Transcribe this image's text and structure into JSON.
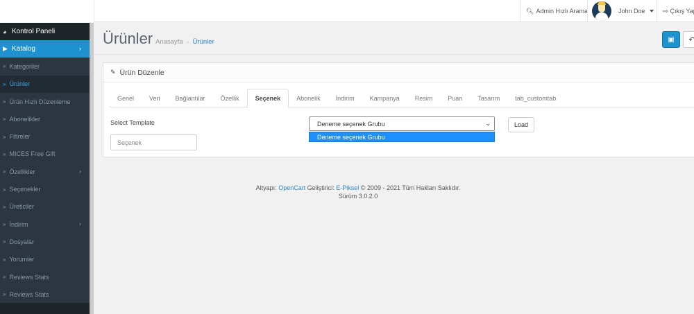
{
  "header": {
    "search_label": "Admin Hızlı Arama",
    "user_name": "John Doe",
    "logout_label": "Çıkış Yap"
  },
  "sidebar": {
    "items": [
      {
        "label": "Kontrol Paneli",
        "icon": "dashboard-icon"
      },
      {
        "label": "Katalog",
        "icon": "tag-icon"
      },
      {
        "label": "Kategoriler"
      },
      {
        "label": "Ürünler"
      },
      {
        "label": "Ürün Hızlı Düzenleme"
      },
      {
        "label": "Abonelikler"
      },
      {
        "label": "Filtreler"
      },
      {
        "label": "MICES Free Gift"
      },
      {
        "label": "Özellikler"
      },
      {
        "label": "Seçenekler"
      },
      {
        "label": "Üreticiler"
      },
      {
        "label": "İndirim"
      },
      {
        "label": "Dosyalar"
      },
      {
        "label": "Yorumlar"
      },
      {
        "label": "Reviews Stats"
      },
      {
        "label": "Reviews Stats"
      }
    ]
  },
  "page": {
    "title": "Ürünler",
    "breadcrumb": [
      "Anasayfa",
      "Ürünler"
    ]
  },
  "panel": {
    "heading": "Ürün Düzenle",
    "tabs": [
      "Genel",
      "Veri",
      "Bağlantılar",
      "Özellik",
      "Seçenek",
      "Abonelik",
      "İndirim",
      "Kampanya",
      "Resim",
      "Puan",
      "Tasarım",
      "tab_customtab"
    ],
    "active_tab": "Seçenek"
  },
  "form": {
    "select_template_label": "Select Template",
    "template_value": "Deneme seçenek Grubu",
    "dropdown_option": "Deneme seçenek Grubu",
    "load_label": "Load",
    "option_placeholder": "Seçenek"
  },
  "footer": {
    "prefix": "Altyapı:",
    "opencart": "OpenCart",
    "dev_label": "Geliştirici:",
    "developer": "E-Piksel",
    "copyright": "© 2009 - 2021 Tüm Hakları Saklıdır.",
    "version": "Sürüm 3.0.2.0"
  },
  "colors": {
    "accent": "#1e91cf",
    "sidebar_bg": "#1e2529",
    "sidebar_sub_bg": "#2b3640",
    "link": "#2a87c4",
    "dropdown_highlight": "#1e90ff"
  }
}
